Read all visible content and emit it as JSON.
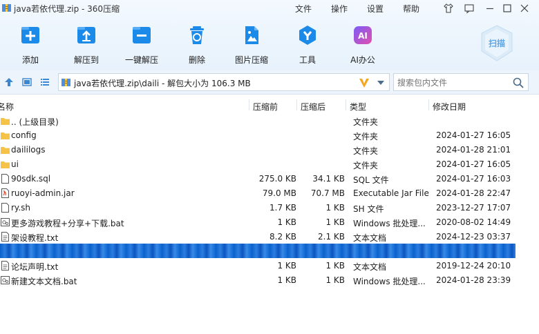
{
  "window": {
    "title": "java若依代理.zip - 360压缩",
    "menu": [
      "文件",
      "操作",
      "设置",
      "帮助"
    ]
  },
  "toolbar": [
    {
      "label": "添加",
      "icon": "add-icon"
    },
    {
      "label": "解压到",
      "icon": "extract-to-icon"
    },
    {
      "label": "一键解压",
      "icon": "one-click-extract-icon"
    },
    {
      "label": "删除",
      "icon": "delete-icon"
    },
    {
      "label": "图片压缩",
      "icon": "image-compress-icon"
    },
    {
      "label": "工具",
      "icon": "tools-icon"
    },
    {
      "label": "AI办公",
      "icon": "ai-office-icon"
    }
  ],
  "scan_label": "扫描",
  "address": {
    "path": "java若依代理.zip\\daili - 解包大小为 106.3 MB"
  },
  "search": {
    "placeholder": "搜索包内文件"
  },
  "columns": [
    "名称",
    "压缩前",
    "压缩后",
    "类型",
    "修改日期"
  ],
  "files": [
    {
      "name": ".. (上级目录)",
      "before": "",
      "after": "",
      "type": "文件夹",
      "date": "",
      "kind": "folder"
    },
    {
      "name": "config",
      "before": "",
      "after": "",
      "type": "文件夹",
      "date": "2024-01-27 16:05",
      "kind": "folder"
    },
    {
      "name": "daililogs",
      "before": "",
      "after": "",
      "type": "文件夹",
      "date": "2024-01-28 21:01",
      "kind": "folder"
    },
    {
      "name": "ui",
      "before": "",
      "after": "",
      "type": "文件夹",
      "date": "2024-01-27 16:05",
      "kind": "folder"
    },
    {
      "name": "90sdk.sql",
      "before": "275.0 KB",
      "after": "34.1 KB",
      "type": "SQL 文件",
      "date": "2024-01-27 16:03",
      "kind": "doc"
    },
    {
      "name": "ruoyi-admin.jar",
      "before": "79.0 MB",
      "after": "70.7 MB",
      "type": "Executable Jar File",
      "date": "2024-01-28 22:47",
      "kind": "jar"
    },
    {
      "name": "ry.sh",
      "before": "1.7 KB",
      "after": "1 KB",
      "type": "SH 文件",
      "date": "2023-12-27 17:07",
      "kind": "doc"
    },
    {
      "name": "更多游戏教程+分享+下载.bat",
      "before": "1 KB",
      "after": "1 KB",
      "type": "Windows 批处理...",
      "date": "2020-08-02 14:49",
      "kind": "bat"
    },
    {
      "name": "架设教程.txt",
      "before": "8.2 KB",
      "after": "2.1 KB",
      "type": "文本文档",
      "date": "2024-12-23 03:37",
      "kind": "txt"
    },
    {
      "name": "",
      "before": "",
      "after": "",
      "type": "",
      "date": "",
      "kind": "selected"
    },
    {
      "name": "论坛声明.txt",
      "before": "1 KB",
      "after": "1 KB",
      "type": "文本文档",
      "date": "2019-12-24 20:10",
      "kind": "txt"
    },
    {
      "name": "新建文本文档.bat",
      "before": "1 KB",
      "after": "1 KB",
      "type": "Windows 批处理...",
      "date": "2024-01-28 23:39",
      "kind": "bat"
    }
  ],
  "colors": {
    "accent": "#1b8ae8",
    "selected": "#0a64d2",
    "folder": "#f6c349"
  }
}
